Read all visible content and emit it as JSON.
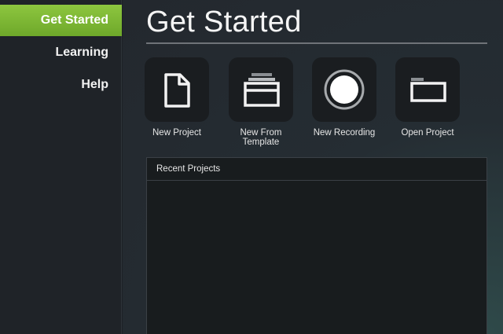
{
  "sidebar": {
    "items": [
      {
        "label": "Get Started",
        "active": true
      },
      {
        "label": "Learning",
        "active": false
      },
      {
        "label": "Help",
        "active": false
      }
    ]
  },
  "main": {
    "title": "Get Started",
    "actions": [
      {
        "label": "New Project",
        "icon": "document-icon"
      },
      {
        "label": "New From\nTemplate",
        "icon": "template-icon"
      },
      {
        "label": "New Recording",
        "icon": "record-icon"
      },
      {
        "label": "Open Project",
        "icon": "folder-icon"
      }
    ],
    "recent": {
      "header": "Recent Projects"
    }
  },
  "colors": {
    "accent": "#8dc63f",
    "sidebar_bg": "#1f2328",
    "tile_bg": "#1a1d20"
  }
}
